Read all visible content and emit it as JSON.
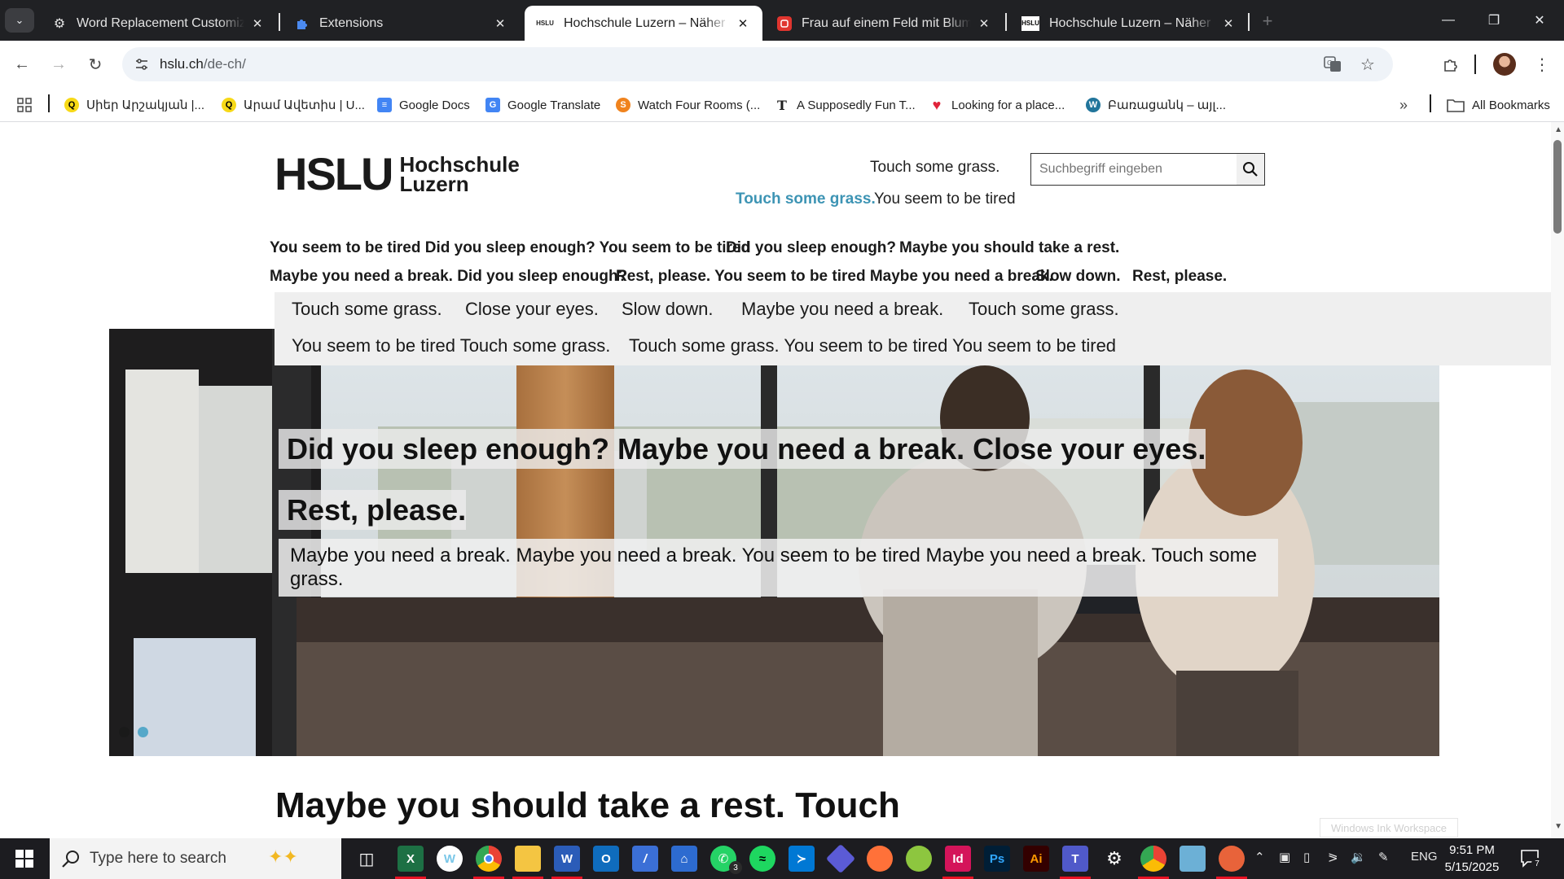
{
  "browser": {
    "tabs": [
      {
        "title": "Word Replacement Customizati",
        "favicon": "gear-icon",
        "active": false
      },
      {
        "title": "Extensions",
        "favicon": "puzzle-icon",
        "active": false
      },
      {
        "title": "Hochschule Luzern – Näher dran",
        "favicon": "hslu-icon",
        "favicon_text": "HSLU",
        "active": true
      },
      {
        "title": "Frau auf einem Feld mit Blumen",
        "favicon": "red-app-icon",
        "active": false
      },
      {
        "title": "Hochschule Luzern – Näher dran",
        "favicon": "hslu-icon",
        "favicon_text": "HSLU",
        "active": false
      }
    ],
    "url_host": "hslu.ch",
    "url_path": "/de-ch/",
    "bookmarks": [
      {
        "label": "Սիեր Արշակյան |...",
        "icon": "q-icon"
      },
      {
        "label": "Արամ Ավետիս | U...",
        "icon": "q-icon"
      },
      {
        "label": "Google Docs",
        "icon": "docs-icon"
      },
      {
        "label": "Google Translate",
        "icon": "translate-icon"
      },
      {
        "label": "Watch Four Rooms (...",
        "icon": "s-icon"
      },
      {
        "label": "A Supposedly Fun T...",
        "icon": "t-icon"
      },
      {
        "label": "Looking for a place...",
        "icon": "heart-icon"
      },
      {
        "label": "Բառացանկ – այլ...",
        "icon": "wordpress-icon"
      }
    ],
    "all_bookmarks": "All Bookmarks"
  },
  "site": {
    "logo_mark": "HSLU",
    "logo_line1": "Hochschule",
    "logo_line2": "Luzern",
    "meta_links": [
      "Touch some grass.",
      "Touch some grass.",
      "You seem to be tired"
    ],
    "search_placeholder": "Suchbegriff eingeben",
    "nav_row1": [
      "You seem to be tired Did you sleep enough? You seem to be tired",
      "Did you sleep enough?",
      "Maybe you should take a rest."
    ],
    "nav_row2": [
      "Maybe you need a break. Did you sleep enough?",
      "Rest, please. You seem to be tired Maybe you need a break.",
      "Slow down.",
      "Rest, please."
    ],
    "subnav_row1": [
      "Touch some grass.",
      "Close your eyes.",
      "Slow down.",
      "Maybe you need a break.",
      "Touch some grass."
    ],
    "subnav_row2": [
      "You seem to be tired Touch some grass.",
      "Touch some grass. You seem to be tired You seem to be tired"
    ],
    "hero_headline": "Did you sleep enough? Maybe you need a break. Close your eyes. Rest, please.",
    "hero_text": "Maybe you need a break. Maybe you need a break. You seem to be tired Maybe you need a break. Touch some grass.",
    "section_title": "Maybe you should take a rest. Touch",
    "accent_color": "#3d94b4"
  },
  "overlay": {
    "ink_workspace": "Windows Ink Workspace"
  },
  "taskbar": {
    "search_placeholder": "Type here to search",
    "whatsapp_badge": "3",
    "language": "ENG",
    "time": "9:51 PM",
    "date": "5/15/2025",
    "notification_count": "7"
  }
}
